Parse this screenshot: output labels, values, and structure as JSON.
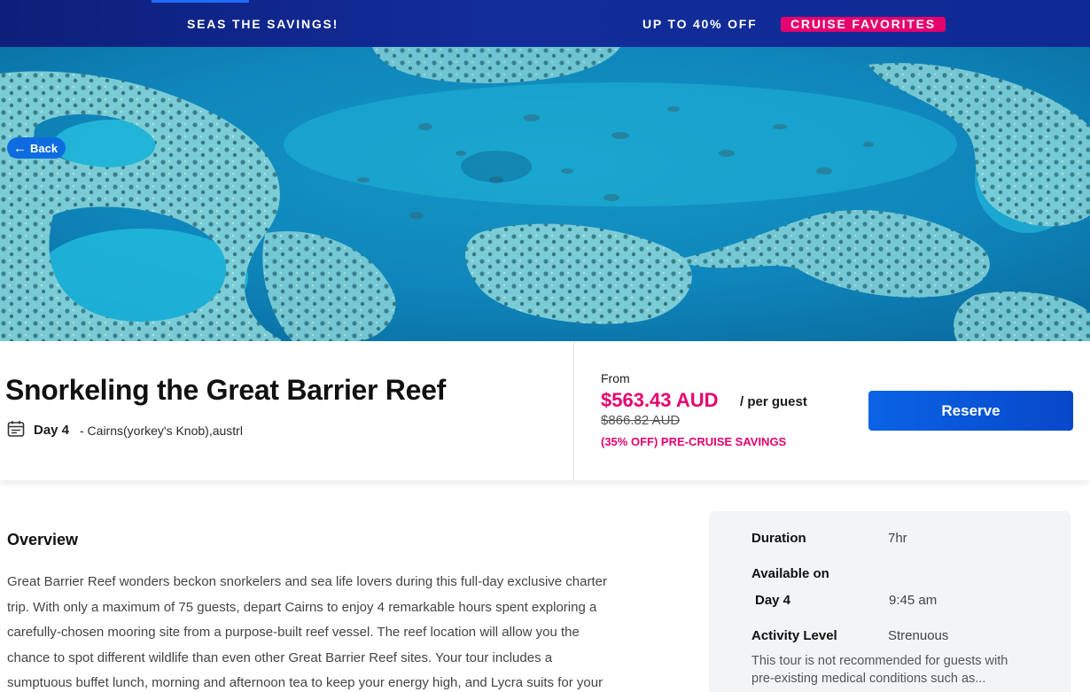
{
  "promo": {
    "left_text": "SEAS THE SAVINGS!",
    "right_text": "UP TO 40% OFF",
    "badge_text": "CRUISE FAVORITES",
    "colors": {
      "banner": "#0f2a94",
      "badge": "#e5006d"
    }
  },
  "hero": {
    "back_label": "Back",
    "image_subject": "aerial view of coral reef in turquoise water"
  },
  "tour": {
    "title": "Snorkeling the Great Barrier Reef",
    "day": "Day 4",
    "port": "- Cairns(yorkey's Knob),austrl"
  },
  "pricing": {
    "from_label": "From",
    "price": "$563.43 AUD",
    "per_guest": "/ per guest",
    "original_price": "$866.82 AUD",
    "savings": "(35% OFF) PRE-CRUISE SAVINGS",
    "reserve_label": "Reserve",
    "accent_color": "#e5006d",
    "button_color": "#0b63e5"
  },
  "overview": {
    "heading": "Overview",
    "lines": [
      "Great Barrier Reef wonders beckon snorkelers and sea life lovers during this full-day exclusive charter",
      "trip. With only a maximum of 75 guests, depart Cairns to enjoy 4 remarkable hours spent exploring a",
      "carefully-chosen mooring site from a purpose-built reef vessel. The reef location will allow you the",
      "chance to spot different wildlife than even other Great Barrier Reef sites. Your tour includes a",
      "sumptuous buffet lunch, morning and afternoon tea to keep your energy high, and Lycra suits for your"
    ]
  },
  "details": {
    "duration_label": "Duration",
    "duration_value": "7hr",
    "available_label": "Available on",
    "available_day": "Day 4",
    "available_time": "9:45 am",
    "activity_label": "Activity Level",
    "activity_value": "Strenuous",
    "note_line1": "This tour is not recommended for guests with",
    "note_line2": "pre-existing medical conditions such as..."
  }
}
